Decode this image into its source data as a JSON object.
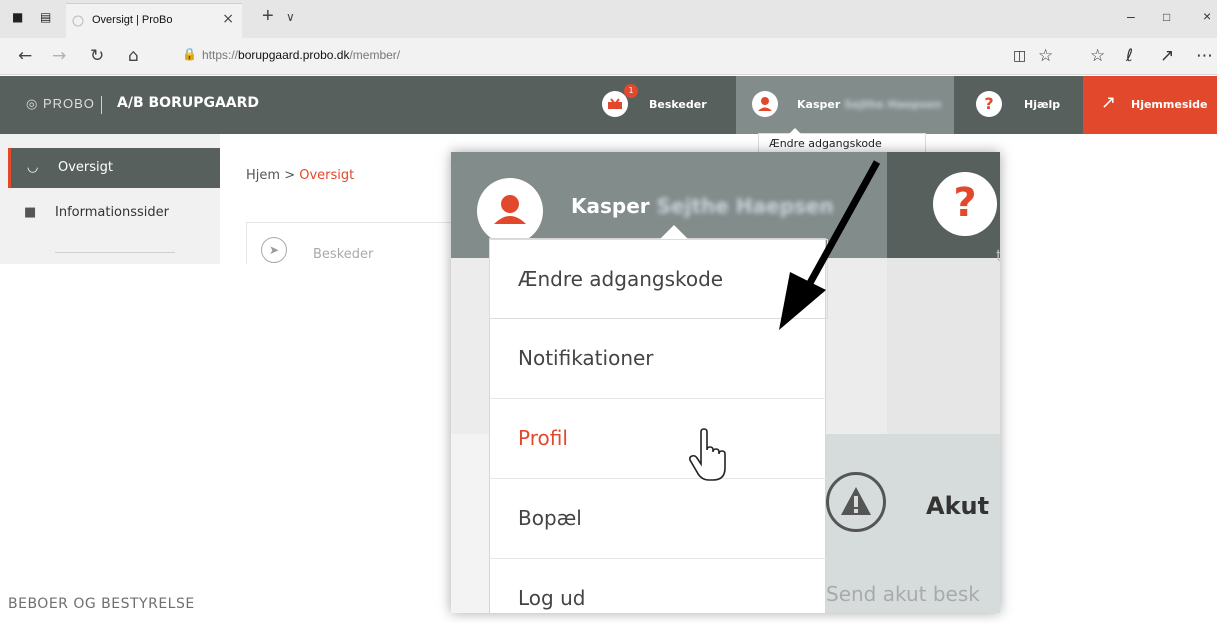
{
  "browser": {
    "tab_title": "Oversigt | ProBo",
    "url_prefix": "https://",
    "url_host": "borupgaard.probo.dk",
    "url_path": "/member/"
  },
  "header": {
    "brand": "PROBO",
    "org_name": "A/B BORUPGAARD",
    "messages_label": "Beskeder",
    "messages_badge": "1",
    "user_first_name": "Kasper",
    "user_last_name_obscured": "Sejthe Haepsen",
    "help_label": "Hjælp",
    "homepage_label": "Hjemmeside",
    "tooltip": "Ændre adgangskode"
  },
  "sidebar": {
    "items": [
      {
        "label": "Oversigt",
        "icon": "dashboard-icon",
        "active": true
      },
      {
        "label": "Informationssider",
        "icon": "book-icon",
        "active": false
      }
    ]
  },
  "breadcrumb": {
    "home": "Hjem",
    "sep": ">",
    "current": "Oversigt"
  },
  "main": {
    "card_label": "Beskeder"
  },
  "zoom": {
    "user_first_name": "Kasper",
    "user_last_name_obscured": "Sejthe Haepsen",
    "help_glyph": "?",
    "right_label": "tbesked",
    "akut_label": "Akut",
    "send_label": "Send akut besk"
  },
  "user_menu": {
    "items": [
      {
        "label": "Ændre adgangskode",
        "highlight": false
      },
      {
        "label": "Notifikationer",
        "highlight": false
      },
      {
        "label": "Profil",
        "highlight": true
      },
      {
        "label": "Bopæl",
        "highlight": false
      },
      {
        "label": "Log ud",
        "highlight": false
      }
    ]
  },
  "footer": "BEBOER OG BESTYRELSE",
  "colors": {
    "accent": "#e2492c",
    "header": "#58605e",
    "user_bg": "#828c8b"
  }
}
